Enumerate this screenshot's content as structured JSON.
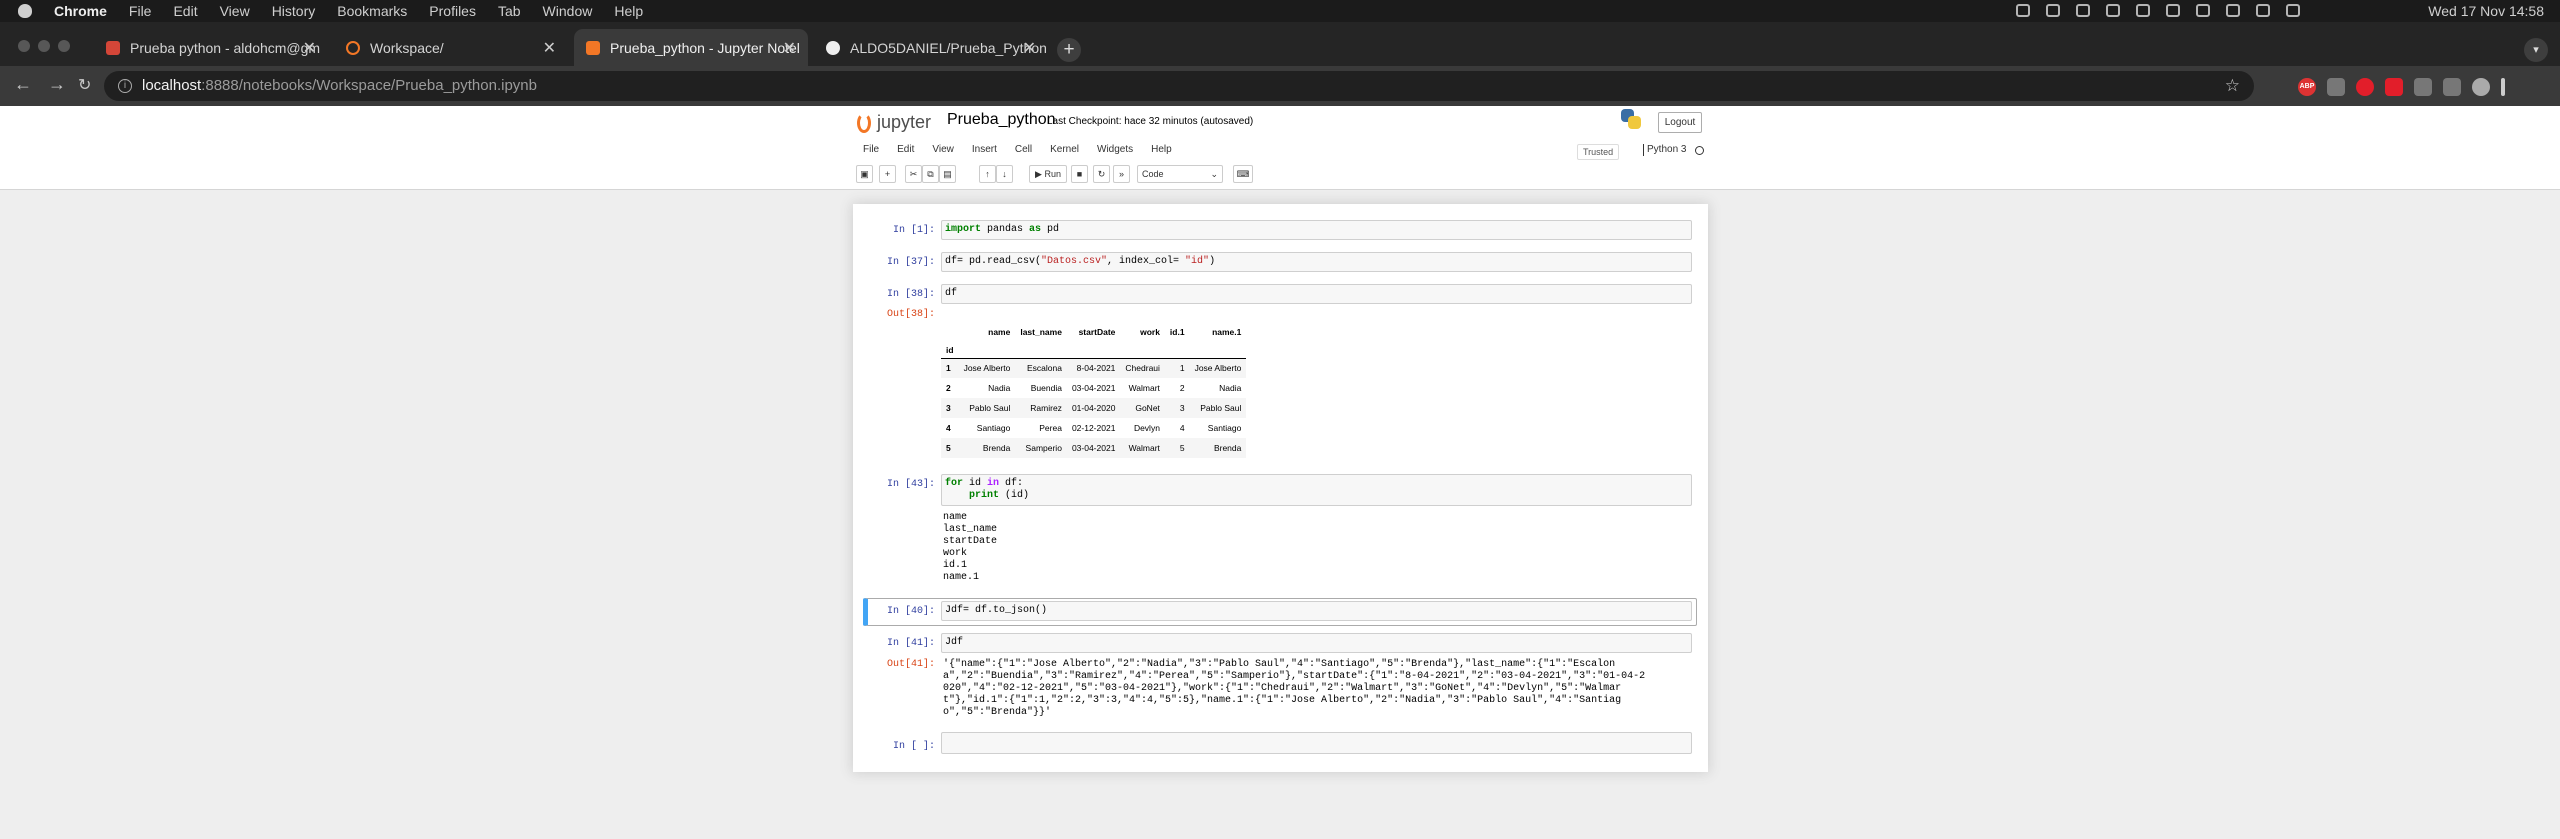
{
  "menubar": {
    "app": "Chrome",
    "items": [
      "File",
      "Edit",
      "View",
      "History",
      "Bookmarks",
      "Profiles",
      "Tab",
      "Window",
      "Help"
    ],
    "clock": "Wed 17 Nov  14:58"
  },
  "tabs": [
    {
      "title": "Prueba python - aldohcm@gm",
      "icon": "gmail-icon"
    },
    {
      "title": "Workspace/",
      "icon": "jupyter-icon"
    },
    {
      "title": "Prueba_python - Jupyter Notel",
      "icon": "jupyter-icon"
    },
    {
      "title": "ALDO5DANIEL/Prueba_Python",
      "icon": "github-icon"
    }
  ],
  "address": {
    "host": "localhost",
    "rest": ":8888/notebooks/Workspace/Prueba_python.ipynb"
  },
  "jupyter": {
    "logo_text": "jupyter",
    "notebook_name": "Prueba_python",
    "checkpoint": "Last Checkpoint: hace 32 minutos  (autosaved)",
    "logout": "Logout",
    "menu": [
      "File",
      "Edit",
      "View",
      "Insert",
      "Cell",
      "Kernel",
      "Widgets",
      "Help"
    ],
    "trusted": "Trusted",
    "kernel": "Python 3",
    "run_label": "Run",
    "cell_type": "Code"
  },
  "cells": {
    "c1": {
      "prompt": "In [1]:"
    },
    "c2": {
      "prompt": "In [37]:"
    },
    "c3": {
      "prompt": "In [38]:",
      "code": "df",
      "out_prompt": "Out[38]:"
    },
    "c4": {
      "prompt": "In [43]:",
      "output": "name\nlast_name\nstartDate\nwork\nid.1\nname.1"
    },
    "c5": {
      "prompt": "In [40]:",
      "code": "Jdf= df.to_json()"
    },
    "c6": {
      "prompt": "In [41]:",
      "code": "Jdf",
      "out_prompt": "Out[41]:",
      "output": "'{\"name\":{\"1\":\"Jose Alberto\",\"2\":\"Nadia\",\"3\":\"Pablo Saul\",\"4\":\"Santiago\",\"5\":\"Brenda\"},\"last_name\":{\"1\":\"Escalon\na\",\"2\":\"Buendia\",\"3\":\"Ramirez\",\"4\":\"Perea\",\"5\":\"Samperio\"},\"startDate\":{\"1\":\"8-04-2021\",\"2\":\"03-04-2021\",\"3\":\"01-04-2\n020\",\"4\":\"02-12-2021\",\"5\":\"03-04-2021\"},\"work\":{\"1\":\"Chedraui\",\"2\":\"Walmart\",\"3\":\"GoNet\",\"4\":\"Devlyn\",\"5\":\"Walmar\nt\"},\"id.1\":{\"1\":1,\"2\":2,\"3\":3,\"4\":4,\"5\":5},\"name.1\":{\"1\":\"Jose Alberto\",\"2\":\"Nadia\",\"3\":\"Pablo Saul\",\"4\":\"Santiag\no\",\"5\":\"Brenda\"}}'"
    },
    "c7": {
      "prompt": "In [ ]:"
    }
  },
  "code_tokens": {
    "import": "import",
    "pandas": " pandas ",
    "as": "as",
    "pd": " pd",
    "df_assign": "df= pd.read_csv(",
    "csv": "\"Datos.csv\"",
    "index_kw": ", index_col= ",
    "id_str": "\"id\"",
    "close": ")",
    "for": "for",
    "id": " id ",
    "in": "in",
    "df": " df:",
    "indent": "\n    ",
    "print": "print",
    "print_args": " (id)"
  },
  "dataframe": {
    "columns": [
      "name",
      "last_name",
      "startDate",
      "work",
      "id.1",
      "name.1"
    ],
    "index_name": "id",
    "rows": [
      {
        "id": "1",
        "cells": [
          "Jose Alberto",
          "Escalona",
          "8-04-2021",
          "Chedraui",
          "1",
          "Jose Alberto"
        ]
      },
      {
        "id": "2",
        "cells": [
          "Nadia",
          "Buendia",
          "03-04-2021",
          "Walmart",
          "2",
          "Nadia"
        ]
      },
      {
        "id": "3",
        "cells": [
          "Pablo Saul",
          "Ramirez",
          "01-04-2020",
          "GoNet",
          "3",
          "Pablo Saul"
        ]
      },
      {
        "id": "4",
        "cells": [
          "Santiago",
          "Perea",
          "02-12-2021",
          "Devlyn",
          "4",
          "Santiago"
        ]
      },
      {
        "id": "5",
        "cells": [
          "Brenda",
          "Samperio",
          "03-04-2021",
          "Walmart",
          "5",
          "Brenda"
        ]
      }
    ]
  }
}
